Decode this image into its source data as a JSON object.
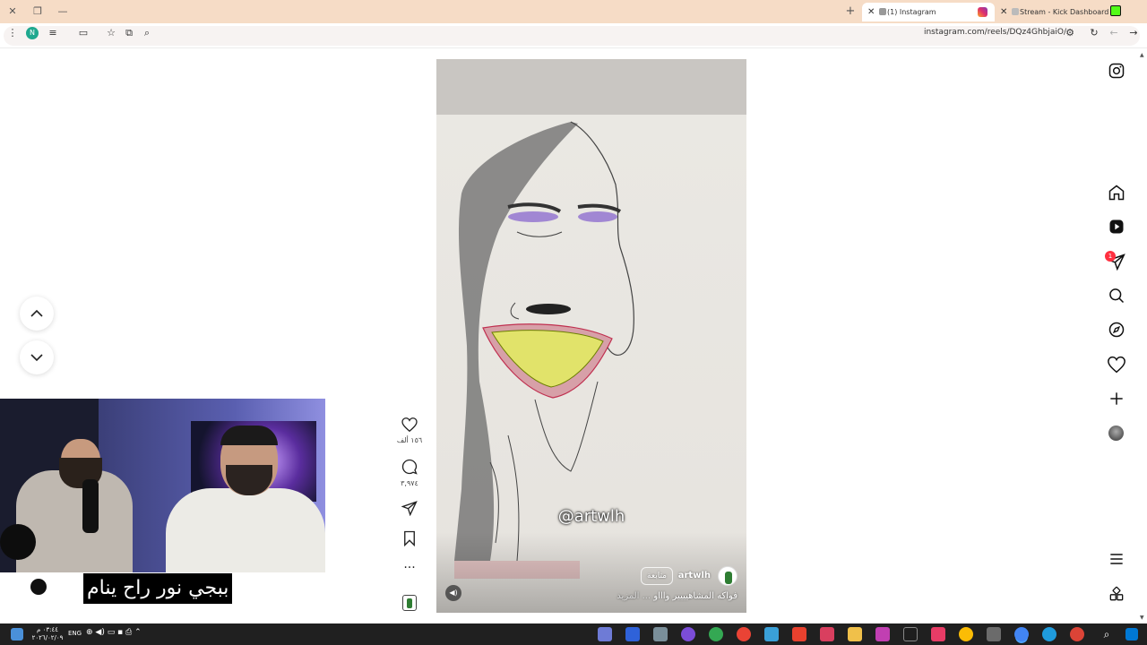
{
  "browser": {
    "tabs": [
      {
        "label": "(1) Instagram",
        "active": true
      },
      {
        "label": "Stream - Kick Dashboard",
        "active": false
      }
    ],
    "url": "instagram.com/reels/DQz4GhbjaiO/",
    "profile_initial": "N"
  },
  "reel": {
    "watermark": "@artwlh",
    "author": "artwlh",
    "follow_label": "متابعة",
    "caption": "فواكه المشاهيييير واااو",
    "caption_more": "... المزيد"
  },
  "actions": {
    "likes": "١٥٦ ألف",
    "comments": "٣,٩٧٤"
  },
  "sidebar": {
    "notification_count": "1",
    "icons": [
      "instagram-logo-icon",
      "home-icon",
      "reels-icon",
      "messages-icon",
      "search-icon",
      "explore-icon",
      "notifications-heart-icon",
      "create-plus-icon",
      "profile-avatar",
      "menu-icon",
      "apps-icon"
    ]
  },
  "overlay": {
    "subtitle": "ببجي نور راح ينام"
  },
  "taskbar": {
    "lang": "ENG",
    "time": "٠٣:٤٤ م",
    "date": "٢٠٢٦/٠٢/٠٩"
  },
  "colors": {
    "tabbar": "#f6dcc6",
    "taskbar": "#202020",
    "badge": "#ff3040"
  }
}
